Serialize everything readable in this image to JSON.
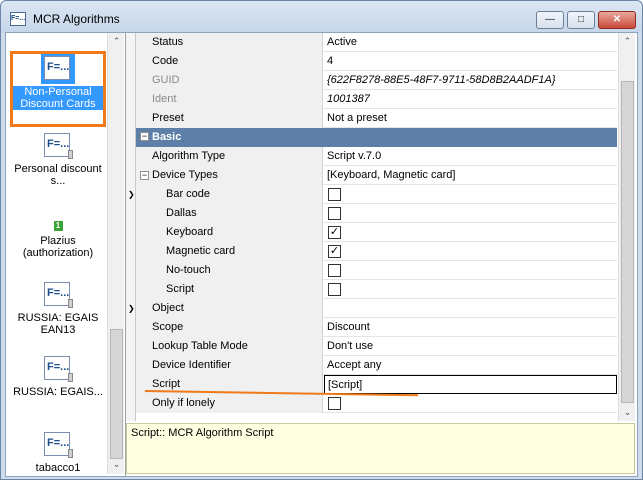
{
  "window": {
    "title": "MCR Algorithms",
    "app_icon": "F=..."
  },
  "left_list": {
    "items": [
      {
        "label": "Non-Personal Discount Cards",
        "icon": "F=...",
        "selected": true
      },
      {
        "label": "Personal discount s...",
        "icon": "F=..."
      },
      {
        "label": "Plazius (authorization)",
        "icon": "1"
      },
      {
        "label": "RUSSIA: EGAIS EAN13",
        "icon": "F=..."
      },
      {
        "label": "RUSSIA: EGAIS...",
        "icon": "F=..."
      },
      {
        "label": "tabacco1",
        "icon": "F=..."
      }
    ]
  },
  "properties": {
    "status": {
      "name": "Status",
      "value": "Active"
    },
    "code": {
      "name": "Code",
      "value": "4"
    },
    "guid": {
      "name": "GUID",
      "value": "{622F8278-88E5-48F7-9711-58D8B2AADF1A}"
    },
    "ident": {
      "name": "Ident",
      "value": "1001387"
    },
    "preset": {
      "name": "Preset",
      "value": "Not a preset"
    },
    "basic": {
      "name": "Basic"
    },
    "algorithm_type": {
      "name": "Algorithm Type",
      "value": "Script v.7.0"
    },
    "device_types": {
      "name": "Device Types",
      "value": "[Keyboard, Magnetic card]"
    },
    "bar_code": {
      "name": "Bar code",
      "checked": false
    },
    "dallas": {
      "name": "Dallas",
      "checked": false
    },
    "keyboard": {
      "name": "Keyboard",
      "checked": true
    },
    "magnetic_card": {
      "name": "Magnetic card",
      "checked": true
    },
    "no_touch": {
      "name": "No-touch",
      "checked": false
    },
    "script_type": {
      "name": "Script",
      "checked": false
    },
    "object": {
      "name": "Object",
      "value": ""
    },
    "scope": {
      "name": "Scope",
      "value": "Discount"
    },
    "lookup_table_mode": {
      "name": "Lookup Table Mode",
      "value": "Don't use"
    },
    "device_identifier": {
      "name": "Device Identifier",
      "value": "Accept any"
    },
    "script": {
      "name": "Script",
      "value": "[Script]"
    },
    "only_if_lonely": {
      "name": "Only if lonely",
      "checked": false
    }
  },
  "description": "Script:: MCR Algorithm Script",
  "colors": {
    "highlight_outline": "#f07a1a",
    "selection": "#3399ff",
    "category_header": "#5d7fa8",
    "description_bg": "#ffffe1"
  }
}
